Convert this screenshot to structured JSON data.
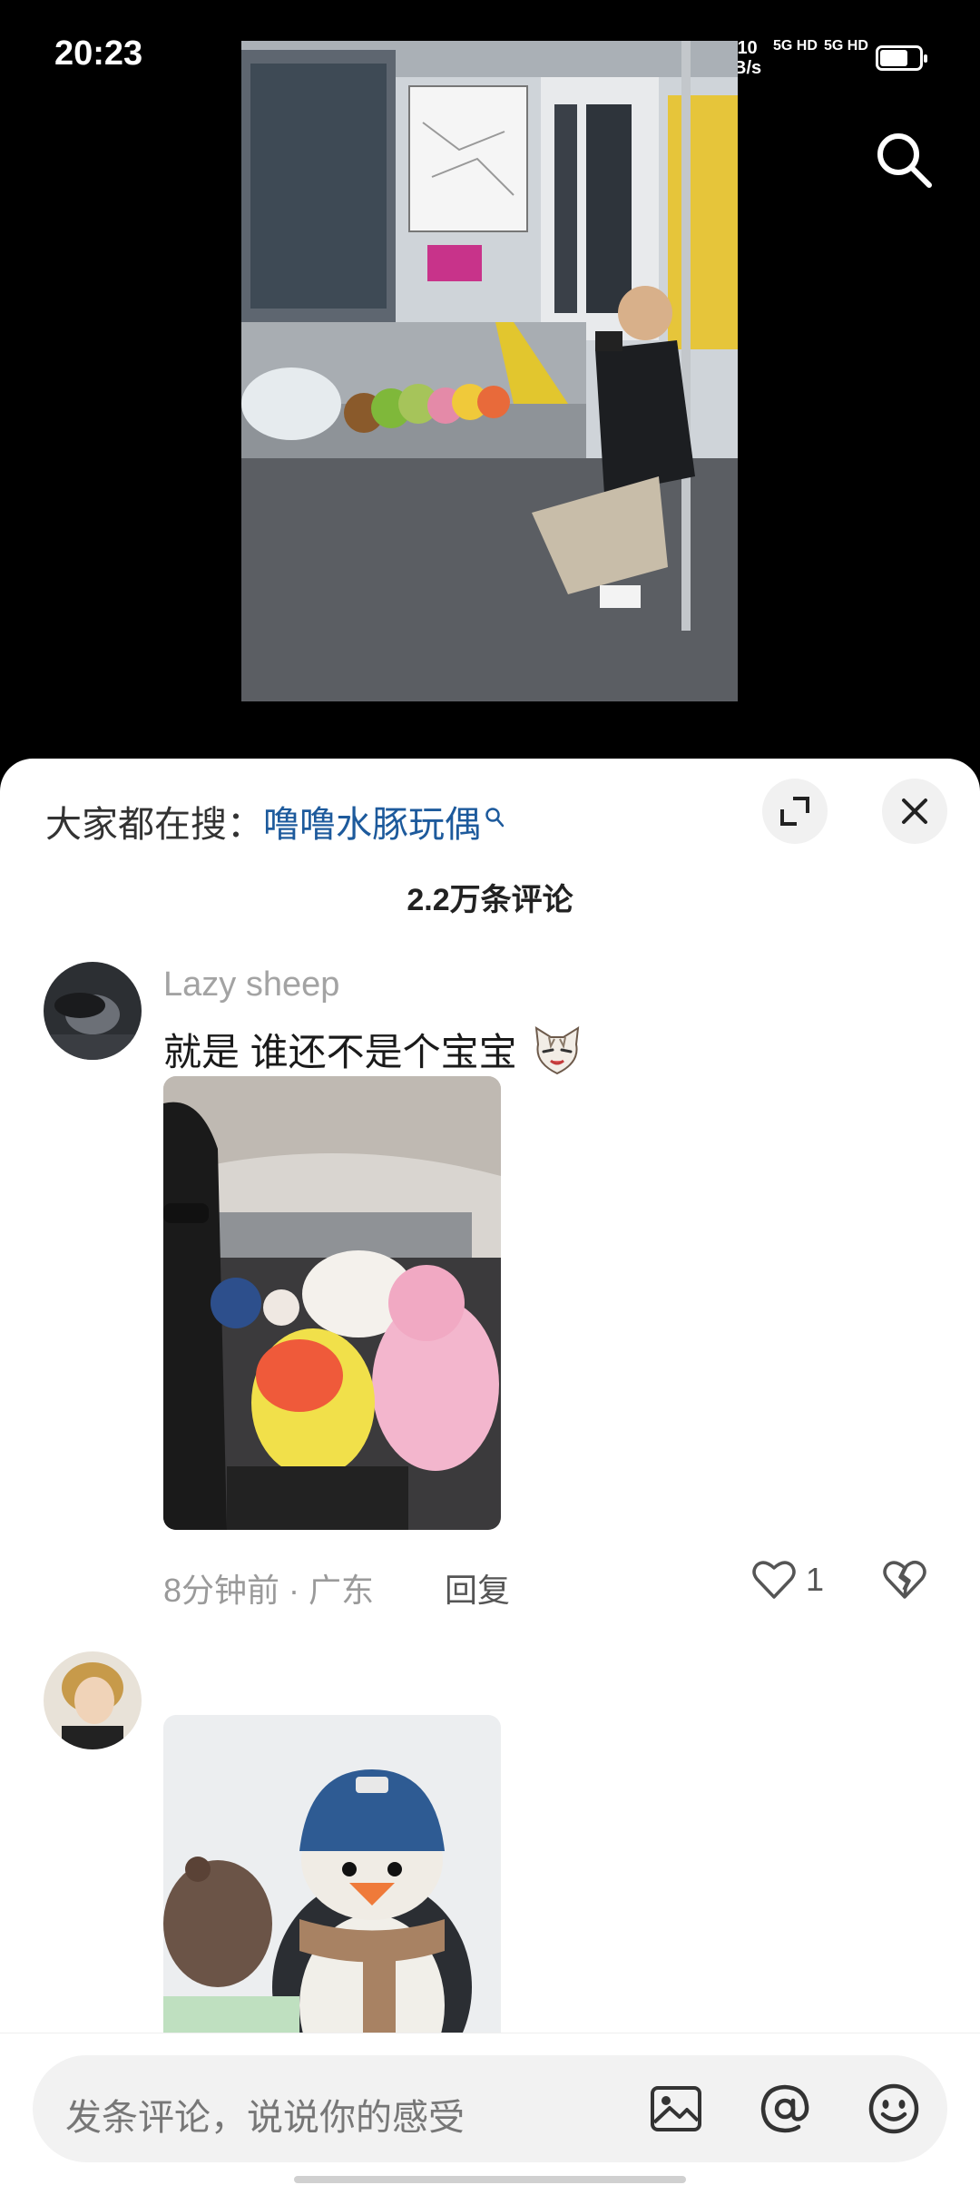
{
  "status_bar": {
    "time": "20:23",
    "network_speed_value": "10",
    "network_speed_unit": "B/s",
    "signal_1": "5G HD",
    "signal_2": "5G HD"
  },
  "icons": {
    "top_search": "search-icon",
    "expand": "expand-icon",
    "close": "close-icon",
    "like": "heart-icon",
    "dislike": "broken-heart-icon",
    "image": "image-icon",
    "mention": "at-icon",
    "emoji": "smiley-icon"
  },
  "sheet": {
    "hot_search_label": "大家都在搜：",
    "hot_search_keyword": "噜噜水豚玩偶",
    "comment_count": "2.2万条评论"
  },
  "comments": [
    {
      "username": "Lazy sheep",
      "text": "就是 谁还不是个宝宝",
      "time": "8分钟前",
      "location": "广东",
      "reply_label": "回复",
      "likes": "1"
    },
    {
      "username": ""
    }
  ],
  "input_bar": {
    "placeholder": "发条评论，说说你的感受"
  },
  "colors": {
    "keyword": "#1d5a9c",
    "sheet_bg": "#ffffff",
    "background": "#000000"
  }
}
